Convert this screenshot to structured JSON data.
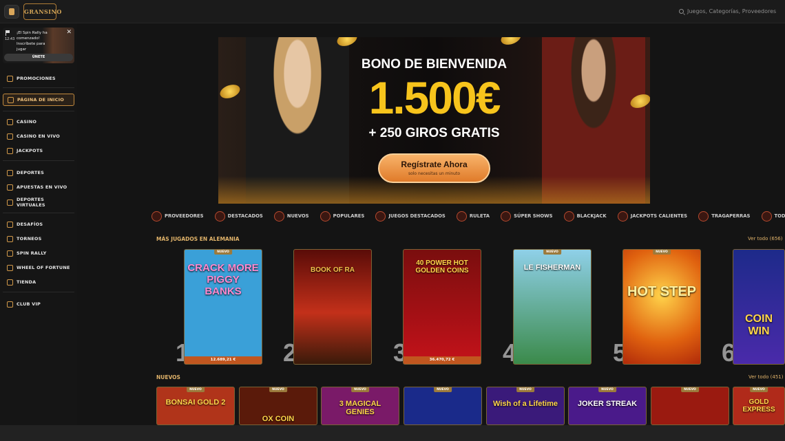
{
  "header": {
    "logo_text": "GRANSINO",
    "search_placeholder": "Juegos, Categorías, Proveedores"
  },
  "notification": {
    "time": "12:43",
    "message": "¡El Spin Rally ha comenzado! Inscríbete para jugar",
    "button": "ÚNETE"
  },
  "sidebar": {
    "items": [
      {
        "label": "PROMOCIONES",
        "icon": "gift-icon"
      },
      {
        "label": "PÁGINA DE INICIO",
        "icon": "home-icon"
      },
      {
        "label": "CASINO",
        "icon": "slot-icon"
      },
      {
        "label": "CASINO EN VIVO",
        "icon": "live-icon"
      },
      {
        "label": "JACKPOTS",
        "icon": "jackpot-icon"
      },
      {
        "label": "DEPORTES",
        "icon": "ball-icon"
      },
      {
        "label": "APUESTAS EN VIVO",
        "icon": "live-bets-icon"
      },
      {
        "label": "DEPORTES VIRTUALES",
        "icon": "virtual-icon"
      },
      {
        "label": "DESAFÍOS",
        "icon": "medal-icon"
      },
      {
        "label": "TORNEOS",
        "icon": "trophy-icon"
      },
      {
        "label": "SPIN RALLY",
        "icon": "rally-icon"
      },
      {
        "label": "WHEEL OF FORTUNE",
        "icon": "wheel-icon"
      },
      {
        "label": "TIENDA",
        "icon": "shop-icon"
      },
      {
        "label": "CLUB VIP",
        "icon": "diamond-icon"
      }
    ]
  },
  "hero": {
    "title": "BONO DE BIENVENIDA",
    "amount": "1.500€",
    "subtitle": "+ 250 GIROS GRATIS",
    "cta": "Regístrate Ahora",
    "cta_sub": "solo necesitas un minuto"
  },
  "categories": [
    "PROVEEDORES",
    "DESTACADOS",
    "NUEVOS",
    "POPULARES",
    "JUEGOS DESTACADOS",
    "RULETA",
    "SÚPER SHOWS",
    "BLACKJACK",
    "JACKPOTS CALIENTES",
    "TRAGAPERRAS",
    "TODOS"
  ],
  "most_played": {
    "title": "MÁS JUGADOS EN ALEMANIA",
    "see_all": "Ver todo (656)",
    "games": [
      {
        "rank": "1",
        "name": "CRACK MORE PIGGY BANKS",
        "badge": "NUEVO",
        "amount": "12.689,21 €",
        "bg": "#3aa0d8"
      },
      {
        "rank": "2",
        "name": "BOOK OF RA",
        "badge": "",
        "amount": "",
        "bg": "#8b1d12"
      },
      {
        "rank": "3",
        "name": "40 POWER HOT GOLDEN COINS",
        "badge": "",
        "amount": "36.470,72 €",
        "bg": "#b4181a"
      },
      {
        "rank": "4",
        "name": "LE FISHERMAN",
        "badge": "NUEVO",
        "amount": "",
        "bg": "#2f7a9a"
      },
      {
        "rank": "5",
        "name": "HOT STEP",
        "badge": "NUEVO",
        "amount": "",
        "bg": "#e06a12"
      },
      {
        "rank": "6",
        "name": "COIN WIN",
        "badge": "",
        "amount": "",
        "bg": "#1d2a8a"
      }
    ]
  },
  "new_games": {
    "title": "NUEVOS",
    "see_all": "Ver todo (451)",
    "games": [
      {
        "name": "BONSAI GOLD 2",
        "badge": "NUEVO",
        "bg": "#b0341a"
      },
      {
        "name": "OX COIN",
        "badge": "NUEVO",
        "bg": "#5a1a0a"
      },
      {
        "name": "3 MAGICAL GENIES",
        "badge": "NUEVO",
        "bg": "#7a1a68"
      },
      {
        "name": "",
        "badge": "NUEVO",
        "bg": "#1a2a8a"
      },
      {
        "name": "Wish of a Lifetime",
        "badge": "NUEVO",
        "bg": "#3a1a7a"
      },
      {
        "name": "JOKER STREAK",
        "badge": "NUEVO",
        "bg": "#4a1a8a"
      },
      {
        "name": "",
        "badge": "NUEVO",
        "bg": "#9a1a10"
      },
      {
        "name": "GOLD EXPRESS",
        "badge": "NUEVO",
        "bg": "#b02a1a"
      }
    ]
  }
}
